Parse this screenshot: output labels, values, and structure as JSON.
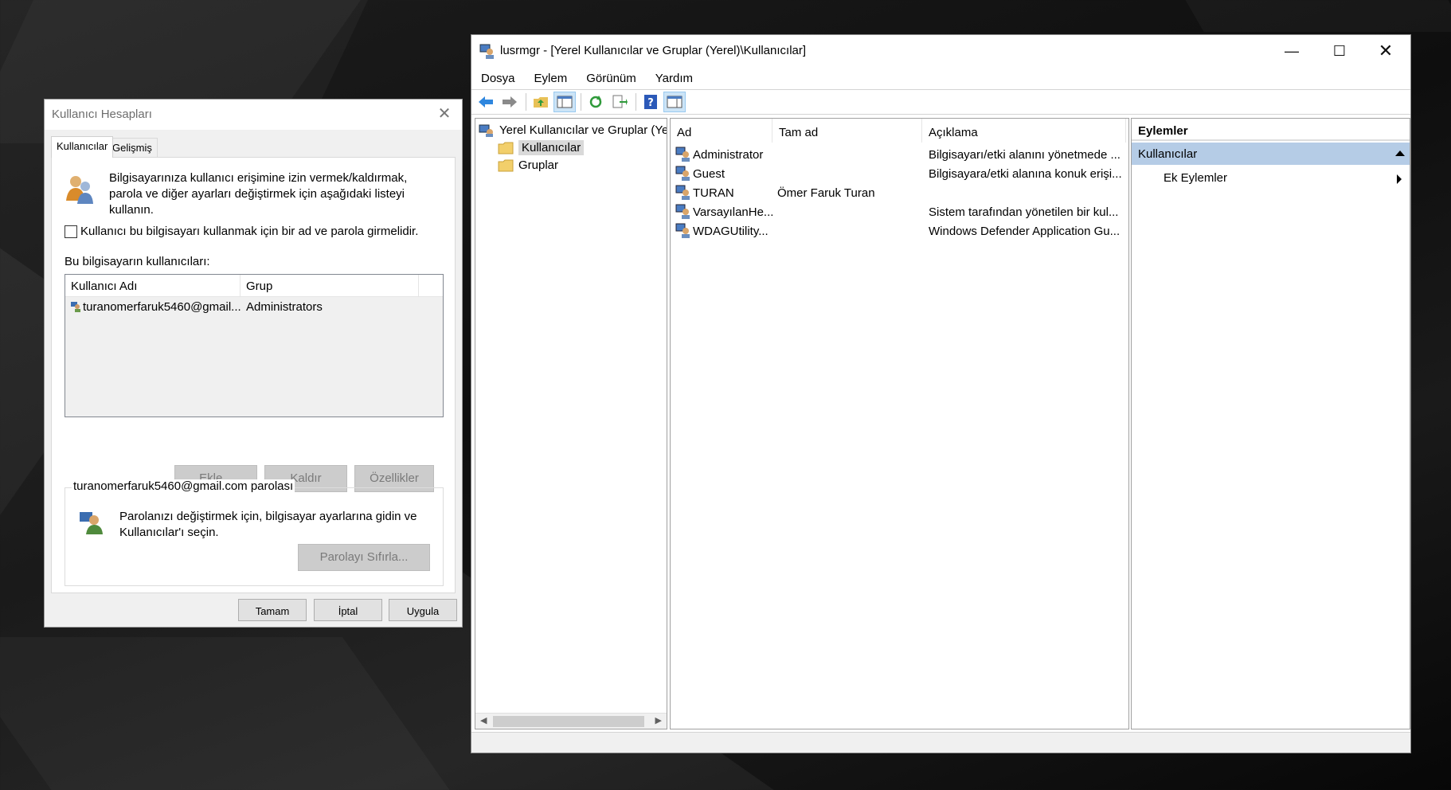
{
  "ua_dialog": {
    "title": "Kullanıcı Hesapları",
    "tabs": [
      "Kullanıcılar",
      "Gelişmiş"
    ],
    "intro": "Bilgisayarınıza kullanıcı erişimine izin vermek/kaldırmak, parola ve diğer ayarları değiştirmek için aşağıdaki listeyi kullanın.",
    "require_login_checkbox": "Kullanıcı bu bilgisayarı kullanmak için bir ad ve parola girmelidir.",
    "list_label": "Bu bilgisayarın kullanıcıları:",
    "columns": [
      "Kullanıcı Adı",
      "Grup"
    ],
    "rows": [
      {
        "user": "turanomerfaruk5460@gmail....",
        "group": "Administrators"
      }
    ],
    "buttons": {
      "add": "Ekle...",
      "remove": "Kaldır",
      "properties": "Özellikler"
    },
    "password_group_title": "turanomerfaruk5460@gmail.com parolası",
    "password_text": "Parolanızı değiştirmek için, bilgisayar ayarlarına gidin ve Kullanıcılar'ı seçin.",
    "reset_password": "Parolayı Sıfırla...",
    "ok": "Tamam",
    "cancel": "İptal",
    "apply": "Uygula"
  },
  "mmc": {
    "title": "lusrmgr - [Yerel Kullanıcılar ve Gruplar (Yerel)\\Kullanıcılar]",
    "menu": [
      "Dosya",
      "Eylem",
      "Görünüm",
      "Yardım"
    ],
    "tree": {
      "root": "Yerel Kullanıcılar ve Gruplar (Yerel)",
      "children": [
        "Kullanıcılar",
        "Gruplar"
      ],
      "selected": "Kullanıcılar"
    },
    "list_columns": [
      "Ad",
      "Tam ad",
      "Açıklama"
    ],
    "users": [
      {
        "name": "Administrator",
        "full_name": "",
        "description": "Bilgisayarı/etki alanını yönetmede ..."
      },
      {
        "name": "Guest",
        "full_name": "",
        "description": "Bilgisayara/etki alanına konuk erişi..."
      },
      {
        "name": "TURAN",
        "full_name": "Ömer Faruk Turan",
        "description": ""
      },
      {
        "name": "VarsayılanHe...",
        "full_name": "",
        "description": "Sistem tarafından yönetilen bir kul..."
      },
      {
        "name": "WDAGUtility...",
        "full_name": "",
        "description": "Windows Defender Application Gu..."
      }
    ],
    "actions": {
      "header": "Eylemler",
      "section": "Kullanıcılar",
      "more": "Ek Eylemler"
    }
  },
  "colors": {
    "selection": "#b5cce6",
    "toolbar_pressed": "#cce4f7"
  }
}
